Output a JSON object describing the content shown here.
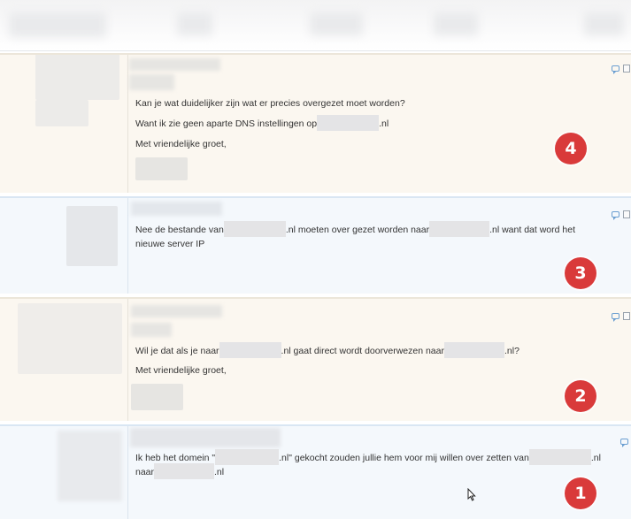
{
  "posts": [
    {
      "id": "post-4",
      "badge": "4",
      "lines": [
        {
          "text": "Kan je wat duidelijker zijn wat er precies overgezet moet worden?"
        },
        {
          "pre": "Want ik zie geen aparte DNS instellingen op",
          "post": ".nl"
        },
        {
          "text": "Met vriendelijke groet,"
        }
      ]
    },
    {
      "id": "post-3",
      "badge": "3",
      "lines": [
        {
          "pre": "Nee de bestande van",
          "mid": ".nl moeten over gezet worden naar",
          "post": ".nl want dat word het"
        },
        {
          "text": "nieuwe server IP"
        }
      ]
    },
    {
      "id": "post-2",
      "badge": "2",
      "lines": [
        {
          "pre": "Wil je dat als je naar",
          "mid": ".nl gaat direct wordt doorverwezen naar",
          "post": ".nl?"
        },
        {
          "text": "Met vriendelijke groet,"
        }
      ]
    },
    {
      "id": "post-1",
      "badge": "1",
      "lines": [
        {
          "pre": "Ik heb het domein \"",
          "mid": ".nl\" gekocht zouden jullie hem voor mij willen over zetten van",
          "post": ".nl"
        },
        {
          "pre": "naar",
          "post": ".nl"
        }
      ]
    }
  ],
  "colors": {
    "customer_bg": "#fbf7f0",
    "staff_bg": "#f4f8fc",
    "badge": "#d93a3a"
  },
  "icons": [
    "quote-icon",
    "checkbox-icon",
    "mouse-cursor-icon"
  ]
}
